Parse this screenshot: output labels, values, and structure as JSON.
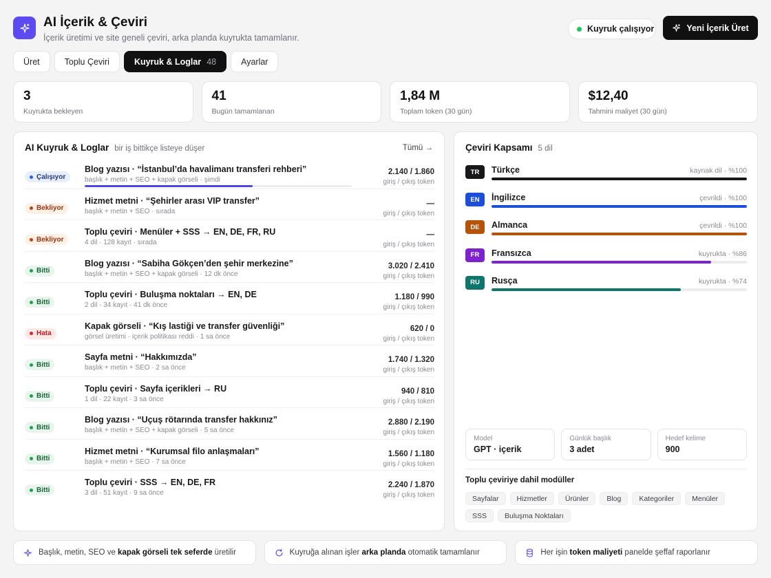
{
  "header": {
    "title": "AI İçerik & Çeviri",
    "subtitle": "İçerik üretimi ve site geneli çeviri, arka planda kuyrukta tamamlanır.",
    "queue_status": "Kuyruk çalışıyor",
    "new_button": "Yeni İçerik Üret"
  },
  "tabs": [
    {
      "label": "Üret"
    },
    {
      "label": "Toplu Çeviri"
    },
    {
      "label": "Kuyruk & Loglar",
      "count": "48"
    },
    {
      "label": "Ayarlar"
    }
  ],
  "stats": [
    {
      "value": "3",
      "label": "Kuyrukta bekleyen"
    },
    {
      "value": "41",
      "label": "Bugün tamamlanan"
    },
    {
      "value": "1,84 M",
      "label": "Toplam token (30 gün)"
    },
    {
      "value": "$12,40",
      "label": "Tahmini maliyet (30 gün)"
    }
  ],
  "queue": {
    "title": "AI Kuyruk & Loglar",
    "subtitle": "bir iş bittikçe listeye düşer",
    "all_link": "Tümü →",
    "rows": [
      {
        "status": "Çalışıyor",
        "title": "Blog yazısı · “İstanbul’da havalimanı transferi rehberi”",
        "meta": "başlık + metin + SEO + kapak görseli · şimdi",
        "value": "2.140 / 1.860",
        "value_label": "giriş / çıkış token",
        "progress": 0.63
      },
      {
        "status": "Bekliyor",
        "title": "Hizmet metni · “Şehirler arası VIP transfer”",
        "meta": "başlık + metin + SEO · sırada",
        "value": "—",
        "value_label": "giriş / çıkış token"
      },
      {
        "status": "Bekliyor",
        "title": "Toplu çeviri · Menüler + SSS → EN, DE, FR, RU",
        "meta": "4 dil · 128 kayıt · sırada",
        "value": "—",
        "value_label": "giriş / çıkış token"
      },
      {
        "status": "Bitti",
        "title": "Blog yazısı · “Sabiha Gökçen’den şehir merkezine”",
        "meta": "başlık + metin + SEO + kapak görseli · 12 dk önce",
        "value": "3.020 / 2.410",
        "value_label": "giriş / çıkış token"
      },
      {
        "status": "Bitti",
        "title": "Toplu çeviri · Buluşma noktaları → EN, DE",
        "meta": "2 dil · 34 kayıt · 41 dk önce",
        "value": "1.180 / 990",
        "value_label": "giriş / çıkış token"
      },
      {
        "status": "Hata",
        "title": "Kapak görseli · “Kış lastiği ve transfer güvenliği”",
        "meta": "görsel üretimi · içerik politikası reddi · 1 sa önce",
        "value": "620 / 0",
        "value_label": "giriş / çıkış token"
      },
      {
        "status": "Bitti",
        "title": "Sayfa metni · “Hakkımızda”",
        "meta": "başlık + metin + SEO · 2 sa önce",
        "value": "1.740 / 1.320",
        "value_label": "giriş / çıkış token"
      },
      {
        "status": "Bitti",
        "title": "Toplu çeviri · Sayfa içerikleri → RU",
        "meta": "1 dil · 22 kayıt · 3 sa önce",
        "value": "940 / 810",
        "value_label": "giriş / çıkış token"
      },
      {
        "status": "Bitti",
        "title": "Blog yazısı · “Uçuş rötarında transfer hakkınız”",
        "meta": "başlık + metin + SEO + kapak görseli · 5 sa önce",
        "value": "2.880 / 2.190",
        "value_label": "giriş / çıkış token"
      },
      {
        "status": "Bitti",
        "title": "Hizmet metni · “Kurumsal filo anlaşmaları”",
        "meta": "başlık + metin + SEO · 7 sa önce",
        "value": "1.560 / 1.180",
        "value_label": "giriş / çıkış token"
      },
      {
        "status": "Bitti",
        "title": "Toplu çeviri · SSS → EN, DE, FR",
        "meta": "3 dil · 51 kayıt · 9 sa önce",
        "value": "2.240 / 1.870",
        "value_label": "giriş / çıkış token"
      }
    ]
  },
  "coverage": {
    "title": "Çeviri Kapsamı",
    "subtitle": "5 dil",
    "languages": [
      {
        "code": "TR",
        "name": "Türkçe",
        "status": "kaynak dil · %100",
        "percent": 100,
        "color": "#18181b"
      },
      {
        "code": "EN",
        "name": "İngilizce",
        "status": "çevrildi · %100",
        "percent": 100,
        "color": "#1d4ed8"
      },
      {
        "code": "DE",
        "name": "Almanca",
        "status": "çevrildi · %100",
        "percent": 100,
        "color": "#b45309"
      },
      {
        "code": "FR",
        "name": "Fransızca",
        "status": "kuyrukta · %86",
        "percent": 86,
        "color": "#7e22ce"
      },
      {
        "code": "RU",
        "name": "Rusça",
        "status": "kuyrukta · %74",
        "percent": 74,
        "color": "#0f766e"
      }
    ],
    "settings": [
      {
        "label": "Model",
        "value": "GPT · içerik"
      },
      {
        "label": "Günlük başlık",
        "value": "3 adet"
      },
      {
        "label": "Hedef kelime",
        "value": "900"
      }
    ],
    "modules_title": "Toplu çeviriye dahil modüller",
    "modules": [
      "Sayfalar",
      "Hizmetler",
      "Ürünler",
      "Blog",
      "Kategoriler",
      "Menüler",
      "SSS",
      "Buluşma Noktaları"
    ]
  },
  "features": [
    {
      "icon": "sparkle-icon",
      "pre": "Başlık, metin, SEO ve ",
      "bold": "kapak görseli tek seferde",
      "post": " üretilir"
    },
    {
      "icon": "refresh-icon",
      "pre": "Kuyruğa alınan işler ",
      "bold": "arka planda",
      "post": " otomatik tamamlanır"
    },
    {
      "icon": "database-icon",
      "pre": "Her işin ",
      "bold": "token maliyeti",
      "post": " panelde şeffaf raporlanır"
    }
  ]
}
